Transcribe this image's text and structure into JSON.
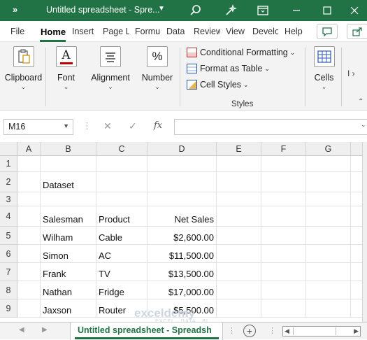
{
  "titlebar": {
    "qat_label": "»",
    "title": "Untitled spreadsheet - Spre...",
    "colors": {
      "background": "#217346",
      "text": "#ffffff"
    },
    "icons": [
      "search-icon",
      "magic-wand-icon",
      "restore-window-icon",
      "minimize-icon",
      "maximize-icon",
      "close-icon"
    ]
  },
  "tabs": [
    {
      "label": "File"
    },
    {
      "label": "Home"
    },
    {
      "label": "Insert"
    },
    {
      "label": "Page L"
    },
    {
      "label": "Formu"
    },
    {
      "label": "Data"
    },
    {
      "label": "Review"
    },
    {
      "label": "View"
    },
    {
      "label": "Develo"
    },
    {
      "label": "Help"
    }
  ],
  "ribbon": {
    "clipboard": "Clipboard",
    "font": "Font",
    "font_icon_glyph": "A",
    "alignment": "Alignment",
    "number": "Number",
    "number_icon_glyph": "%",
    "cells": "Cells",
    "conditional_formatting": "Conditional Formatting",
    "format_as_table": "Format as Table",
    "cell_styles": "Cell Styles",
    "styles_group": "Styles",
    "chevron": "⌄",
    "dropdown_caret": "⌄"
  },
  "formula_bar": {
    "name_box": "M16",
    "fx_label": "fx",
    "cancel_icon": "✕",
    "enter_icon": "✓",
    "formula": ""
  },
  "grid": {
    "columns": [
      "A",
      "B",
      "C",
      "D",
      "E",
      "F",
      "G"
    ],
    "rows": [
      "1",
      "2",
      "3",
      "4",
      "5",
      "6",
      "7",
      "8",
      "9"
    ],
    "cells": {
      "B2": "Dataset",
      "B4": "Salesman",
      "C4": "Product",
      "D4": "Net Sales",
      "B5": "Wilham",
      "C5": "Cable",
      "D5": "$2,600.00",
      "B6": "Simon",
      "C6": "AC",
      "D6": "$11,500.00",
      "B7": "Frank",
      "C7": "TV",
      "D7": "$13,500.00",
      "B8": "Nathan",
      "C8": "Fridge",
      "D8": "$17,000.00",
      "B9": "Jaxson",
      "C9": "Router",
      "D9": "$5,500.00"
    }
  },
  "sheetbar": {
    "sheet_tab": "Untitled spreadsheet - Spreadsh",
    "add_sheet": "+",
    "accent": "#217346"
  },
  "watermark": {
    "name": "exceldemy",
    "tagline": "EXCEL · DATA · BI"
  }
}
